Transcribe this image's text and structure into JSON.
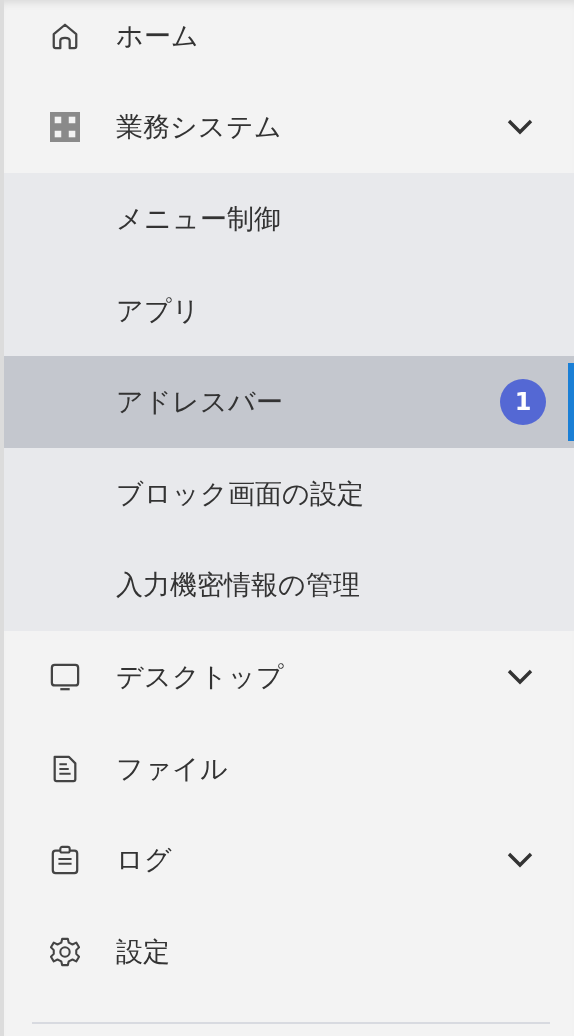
{
  "sidebar": {
    "items": [
      {
        "label": "ホーム",
        "kind": "link"
      },
      {
        "label": "業務システム",
        "kind": "group",
        "children": [
          {
            "label": "メニュー制御",
            "selected": false
          },
          {
            "label": "アプリ",
            "selected": false
          },
          {
            "label": "アドレスバー",
            "selected": true,
            "badge": "1"
          },
          {
            "label": "ブロック画面の設定",
            "selected": false
          },
          {
            "label": "入力機密情報の管理",
            "selected": false
          }
        ]
      },
      {
        "label": "デスクトップ",
        "kind": "group"
      },
      {
        "label": "ファイル",
        "kind": "link"
      },
      {
        "label": "ログ",
        "kind": "group"
      },
      {
        "label": "設定",
        "kind": "link"
      }
    ]
  }
}
